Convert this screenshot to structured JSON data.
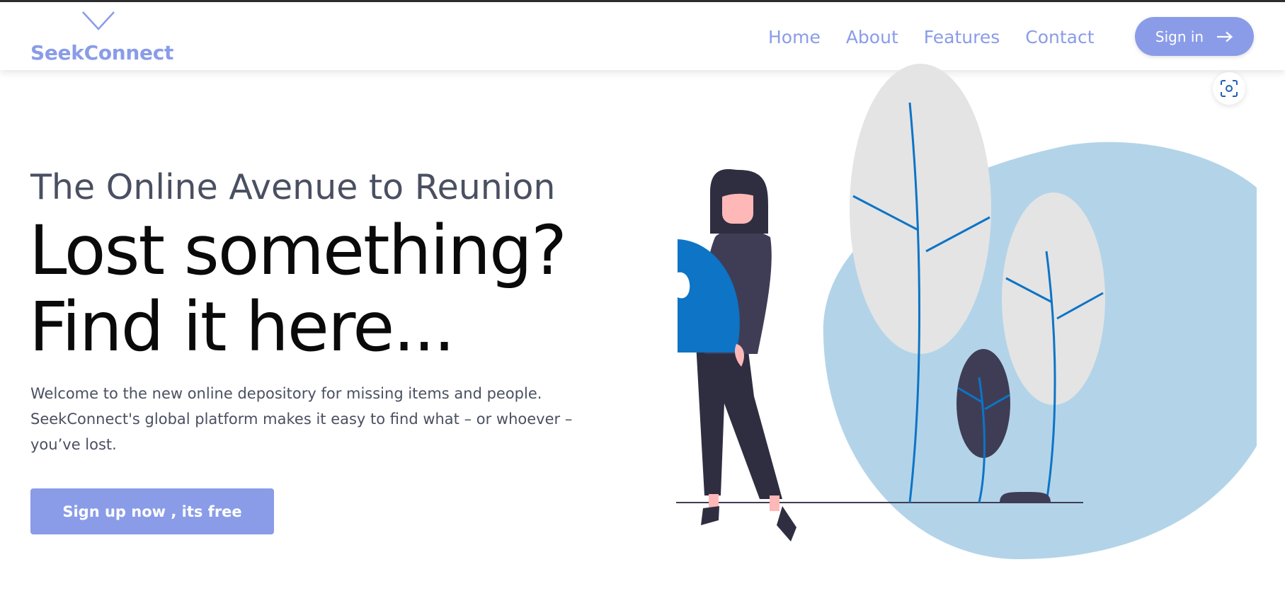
{
  "header": {
    "brand": "SeekConnect",
    "nav": [
      {
        "label": "Home"
      },
      {
        "label": "About"
      },
      {
        "label": "Features"
      },
      {
        "label": "Contact"
      }
    ],
    "signin_label": "Sign in"
  },
  "hero": {
    "subtitle": "The Online Avenue to Reunion",
    "headline_line1": "Lost something?",
    "headline_line2": "Find it here...",
    "description": "Welcome to the new online depository for missing items and people. SeekConnect's global platform makes it easy to find what – or whoever – you’ve lost.",
    "cta_label": "Sign up now , its free"
  },
  "icons": [
    "chevron-down-icon",
    "arrow-right-icon",
    "scan-icon"
  ],
  "colors": {
    "accent": "#8a9ce8",
    "blob": "#b3d4e8",
    "leaf": "#e4e4e4",
    "stem": "#0d74c6",
    "figure_dark": "#3f3d56",
    "skin": "#ffb8b8"
  }
}
